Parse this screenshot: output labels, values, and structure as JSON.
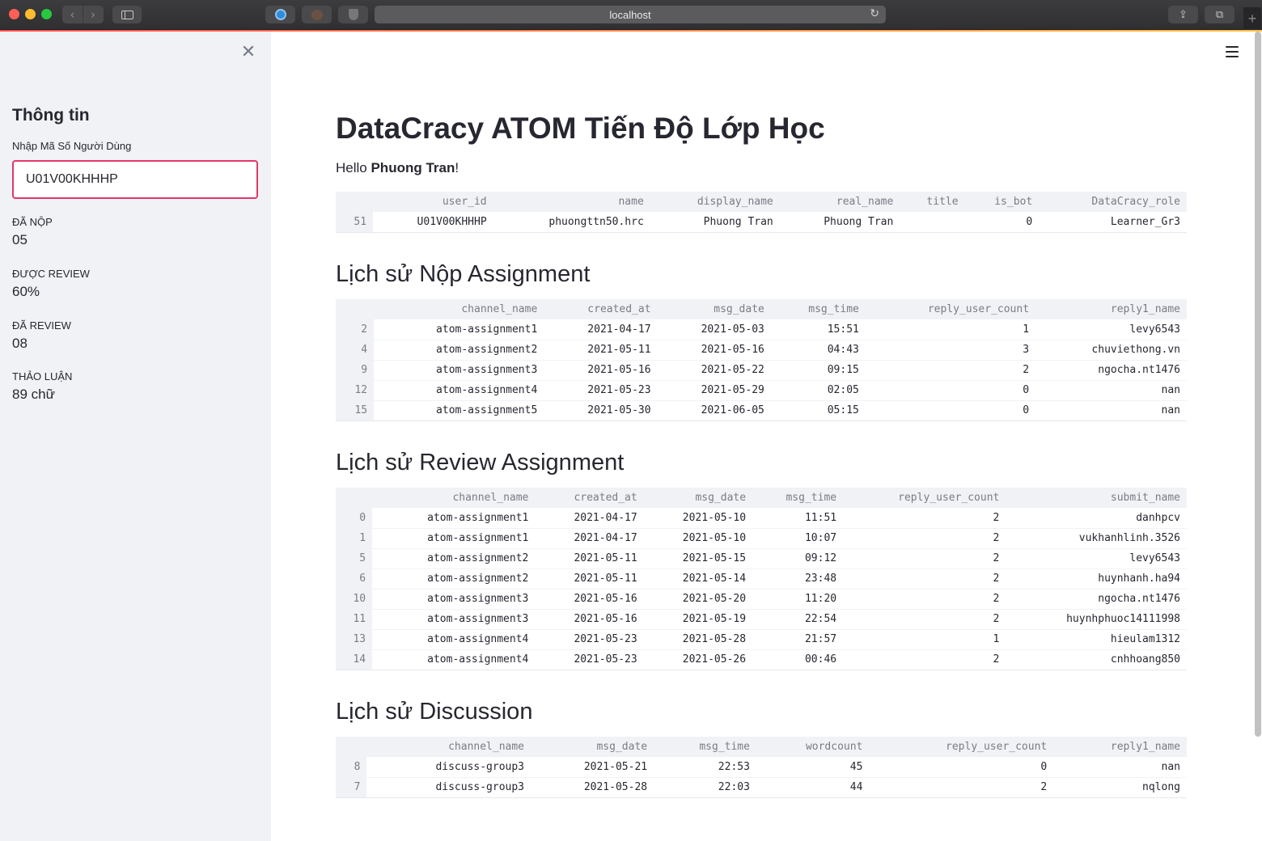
{
  "browser": {
    "url": "localhost"
  },
  "sidebar": {
    "title": "Thông tin",
    "input_label": "Nhập Mã Số Người Dùng",
    "input_value": "U01V00KHHHP",
    "metrics": [
      {
        "label": "ĐÃ NỘP",
        "value": "05"
      },
      {
        "label": "ĐƯỢC REVIEW",
        "value": "60%"
      },
      {
        "label": "ĐÃ REVIEW",
        "value": "08"
      },
      {
        "label": "THẢO LUẬN",
        "value": "89 chữ"
      }
    ]
  },
  "main": {
    "title": "DataCracy ATOM Tiến Độ Lớp Học",
    "hello_prefix": "Hello ",
    "hello_name": "Phuong Tran",
    "hello_suffix": "!",
    "user_table": {
      "columns": [
        "",
        "user_id",
        "name",
        "display_name",
        "real_name",
        "title",
        "is_bot",
        "DataCracy_role"
      ],
      "rows": [
        [
          "51",
          "U01V00KHHHP",
          "phuongttn50.hrc",
          "Phuong Tran",
          "Phuong Tran",
          "",
          "0",
          "Learner_Gr3"
        ]
      ]
    },
    "submit_section_title": "Lịch sử Nộp Assignment",
    "submit_table": {
      "columns": [
        "",
        "channel_name",
        "created_at",
        "msg_date",
        "msg_time",
        "reply_user_count",
        "reply1_name"
      ],
      "rows": [
        [
          "2",
          "atom-assignment1",
          "2021-04-17",
          "2021-05-03",
          "15:51",
          "1",
          "levy6543"
        ],
        [
          "4",
          "atom-assignment2",
          "2021-05-11",
          "2021-05-16",
          "04:43",
          "3",
          "chuviethong.vn"
        ],
        [
          "9",
          "atom-assignment3",
          "2021-05-16",
          "2021-05-22",
          "09:15",
          "2",
          "ngocha.nt1476"
        ],
        [
          "12",
          "atom-assignment4",
          "2021-05-23",
          "2021-05-29",
          "02:05",
          "0",
          "nan"
        ],
        [
          "15",
          "atom-assignment5",
          "2021-05-30",
          "2021-06-05",
          "05:15",
          "0",
          "nan"
        ]
      ]
    },
    "review_section_title": "Lịch sử Review Assignment",
    "review_table": {
      "columns": [
        "",
        "channel_name",
        "created_at",
        "msg_date",
        "msg_time",
        "reply_user_count",
        "submit_name"
      ],
      "rows": [
        [
          "0",
          "atom-assignment1",
          "2021-04-17",
          "2021-05-10",
          "11:51",
          "2",
          "danhpcv"
        ],
        [
          "1",
          "atom-assignment1",
          "2021-04-17",
          "2021-05-10",
          "10:07",
          "2",
          "vukhanhlinh.3526"
        ],
        [
          "5",
          "atom-assignment2",
          "2021-05-11",
          "2021-05-15",
          "09:12",
          "2",
          "levy6543"
        ],
        [
          "6",
          "atom-assignment2",
          "2021-05-11",
          "2021-05-14",
          "23:48",
          "2",
          "huynhanh.ha94"
        ],
        [
          "10",
          "atom-assignment3",
          "2021-05-16",
          "2021-05-20",
          "11:20",
          "2",
          "ngocha.nt1476"
        ],
        [
          "11",
          "atom-assignment3",
          "2021-05-16",
          "2021-05-19",
          "22:54",
          "2",
          "huynhphuoc14111998"
        ],
        [
          "13",
          "atom-assignment4",
          "2021-05-23",
          "2021-05-28",
          "21:57",
          "1",
          "hieulam1312"
        ],
        [
          "14",
          "atom-assignment4",
          "2021-05-23",
          "2021-05-26",
          "00:46",
          "2",
          "cnhhoang850"
        ]
      ]
    },
    "discussion_section_title": "Lịch sử Discussion",
    "discussion_table": {
      "columns": [
        "",
        "channel_name",
        "msg_date",
        "msg_time",
        "wordcount",
        "reply_user_count",
        "reply1_name"
      ],
      "rows": [
        [
          "8",
          "discuss-group3",
          "2021-05-21",
          "22:53",
          "45",
          "0",
          "nan"
        ],
        [
          "7",
          "discuss-group3",
          "2021-05-28",
          "22:03",
          "44",
          "2",
          "nqlong"
        ]
      ]
    }
  },
  "colors": {
    "accent": "#ff4b4b",
    "input_focus_border": "#e0386b",
    "sidebar_bg": "#f0f2f6",
    "text": "#262730"
  },
  "icons": {
    "back": "chevron-left-icon",
    "forward": "chevron-right-icon",
    "sidebar_toggle": "sidebar-icon",
    "reload": "reload-icon",
    "share": "share-icon",
    "tabs": "tabs-icon",
    "close_sidebar": "close-icon",
    "menu": "hamburger-menu-icon"
  }
}
